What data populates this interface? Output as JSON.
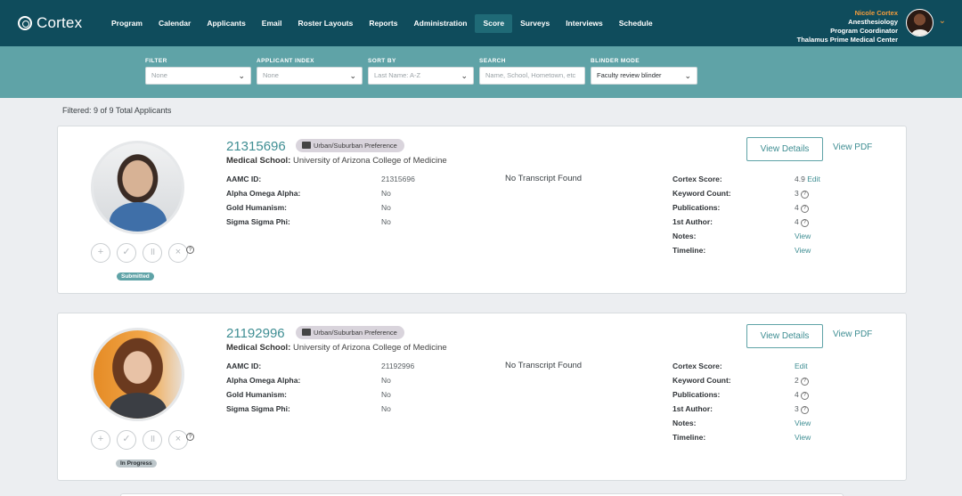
{
  "app": {
    "name": "Cortex"
  },
  "nav": [
    "Program",
    "Calendar",
    "Applicants",
    "Email",
    "Roster Layouts",
    "Reports",
    "Administration",
    "Score",
    "Surveys",
    "Interviews",
    "Schedule"
  ],
  "nav_active": "Score",
  "user": {
    "name": "Nicole Cortex",
    "department": "Anesthesiology",
    "role": "Program Coordinator",
    "org": "Thalamus Prime Medical Center"
  },
  "filters": {
    "filter": {
      "label": "FILTER",
      "value": "None"
    },
    "applicant_index": {
      "label": "APPLICANT INDEX",
      "value": "None"
    },
    "sort_by": {
      "label": "SORT BY",
      "value": "Last Name: A-Z"
    },
    "search": {
      "label": "SEARCH",
      "placeholder": "Name, School, Hometown, etc"
    },
    "blinder_mode": {
      "label": "BLINDER MODE",
      "value": "Faculty review blinder"
    }
  },
  "filtered_text": "Filtered: 9 of 9 Total Applicants",
  "labels": {
    "medical_school": "Medical School:",
    "aamc_id": "AAMC ID:",
    "aoa": "Alpha Omega Alpha:",
    "gold": "Gold Humanism:",
    "sigma": "Sigma Sigma Phi:",
    "cortex_score": "Cortex Score:",
    "keyword_count": "Keyword Count:",
    "publications": "Publications:",
    "first_author": "1st Author:",
    "notes": "Notes:",
    "timeline": "Timeline:",
    "view_details": "View Details",
    "view_pdf": "View PDF",
    "view": "View",
    "edit": "Edit",
    "transcript": "No Transcript Found"
  },
  "applicants": [
    {
      "id": "21315696",
      "preference": "Urban/Suburban Preference",
      "medical_school": "University of Arizona College of Medicine",
      "aamc_id": "21315696",
      "aoa": "No",
      "gold": "No",
      "sigma": "No",
      "cortex_score": "4.9",
      "keyword_count": "3",
      "publications": "4",
      "first_author": "4",
      "status": "Submitted"
    },
    {
      "id": "21192996",
      "preference": "Urban/Suburban Preference",
      "medical_school": "University of Arizona College of Medicine",
      "aamc_id": "21192996",
      "aoa": "No",
      "gold": "No",
      "sigma": "No",
      "cortex_score": "",
      "keyword_count": "2",
      "publications": "4",
      "first_author": "3",
      "status": "In Progress"
    }
  ],
  "colors": {
    "nav_bg": "#0f4c5c",
    "filter_bg": "#5fa3a7",
    "accent": "#3f8e93",
    "user_name": "#f39c3c"
  }
}
